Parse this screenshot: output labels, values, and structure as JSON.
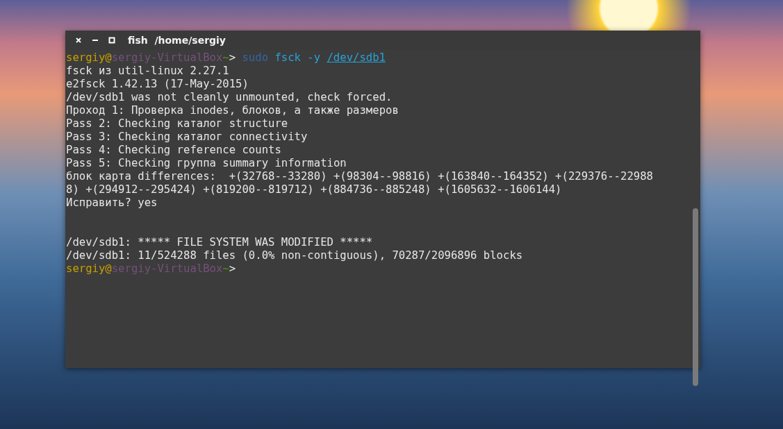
{
  "window": {
    "title": "fish  /home/sergiy"
  },
  "terminal": {
    "lines": [
      {
        "kind": "prompt",
        "segments": [
          {
            "kind": "user",
            "text": "sergiy@"
          },
          {
            "kind": "host",
            "text": "sergiy-VirtualBox"
          },
          {
            "kind": "cwd",
            "text": "~"
          },
          {
            "kind": "arrow",
            "text": ">"
          },
          {
            "kind": "builtin",
            "text": "sudo"
          },
          {
            "kind": "command",
            "text": "fsck -y"
          },
          {
            "kind": "path",
            "text": "/dev/sdb1"
          }
        ]
      },
      {
        "kind": "output",
        "text": "fsck из util-linux 2.27.1"
      },
      {
        "kind": "output",
        "text": "e2fsck 1.42.13 (17-May-2015)"
      },
      {
        "kind": "output",
        "text": "/dev/sdb1 was not cleanly unmounted, check forced."
      },
      {
        "kind": "output",
        "text": "Проход 1: Проверка inodes, блоков, а также размеров"
      },
      {
        "kind": "output",
        "text": "Pass 2: Checking каталог structure"
      },
      {
        "kind": "output",
        "text": "Pass 3: Checking каталог connectivity"
      },
      {
        "kind": "output",
        "text": "Pass 4: Checking reference counts"
      },
      {
        "kind": "output",
        "text": "Pass 5: Checking группа summary information"
      },
      {
        "kind": "output",
        "text": "блок карта differences:  +(32768--33280) +(98304--98816) +(163840--164352) +(229376--22988"
      },
      {
        "kind": "output",
        "text": "8) +(294912--295424) +(819200--819712) +(884736--885248) +(1605632--1606144)"
      },
      {
        "kind": "output",
        "text": "Исправить? yes"
      },
      {
        "kind": "blank"
      },
      {
        "kind": "blank"
      },
      {
        "kind": "output",
        "text": "/dev/sdb1: ***** FILE SYSTEM WAS MODIFIED *****"
      },
      {
        "kind": "output",
        "text": "/dev/sdb1: 11/524288 files (0.0% non-contiguous), 70287/2096896 blocks"
      },
      {
        "kind": "prompt",
        "segments": [
          {
            "kind": "user",
            "text": "sergiy@"
          },
          {
            "kind": "host",
            "text": "sergiy-VirtualBox"
          },
          {
            "kind": "cwd",
            "text": "~"
          },
          {
            "kind": "arrow",
            "text": ">"
          }
        ]
      }
    ]
  }
}
